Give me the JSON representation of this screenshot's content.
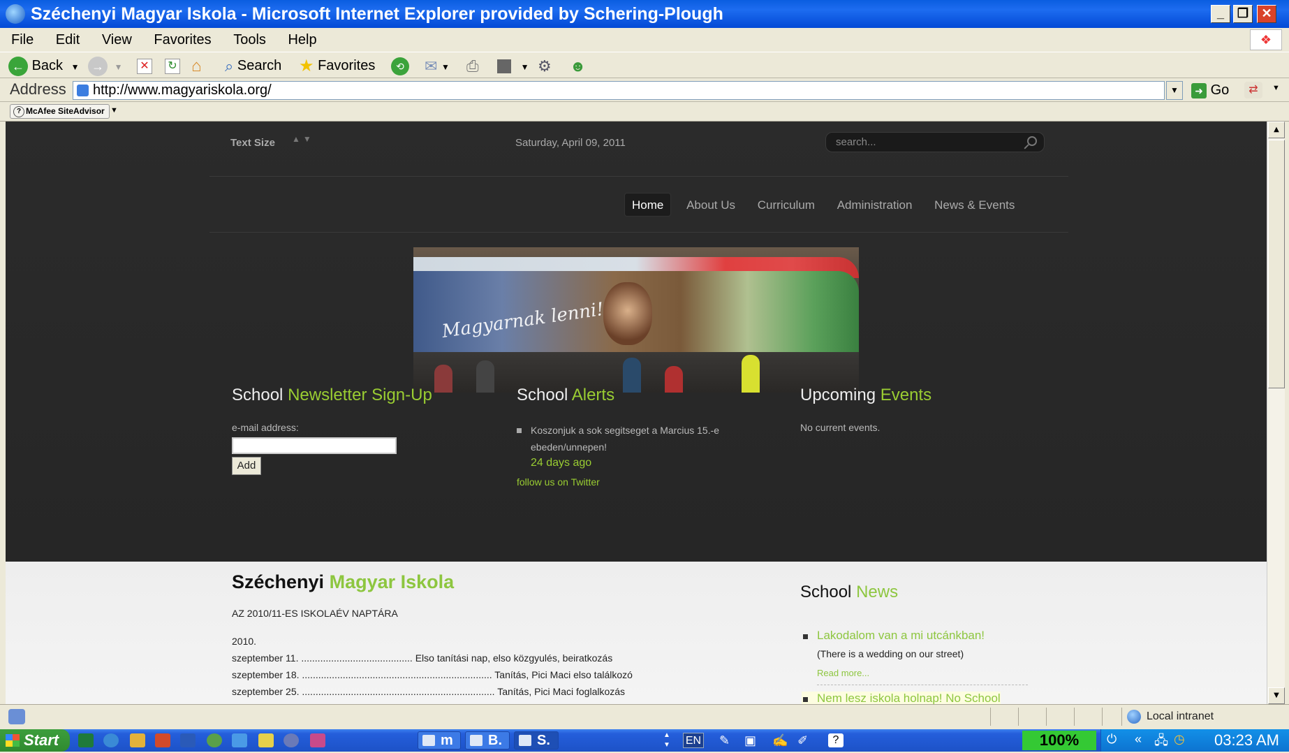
{
  "window": {
    "title": "Széchenyi Magyar Iskola - Microsoft Internet Explorer provided by Schering-Plough"
  },
  "menu": [
    "File",
    "Edit",
    "View",
    "Favorites",
    "Tools",
    "Help"
  ],
  "toolbar": {
    "back_label": "Back",
    "search_label": "Search",
    "favorites_label": "Favorites"
  },
  "address": {
    "label": "Address",
    "url": "http://www.magyariskola.org/",
    "go_label": "Go"
  },
  "siteadvisor": {
    "label": "McAfee SiteAdvisor"
  },
  "page": {
    "text_size_label": "Text Size",
    "date": "Saturday, April 09, 2011",
    "search_placeholder": "search...",
    "nav": [
      "Home",
      "About Us",
      "Curriculum",
      "Administration",
      "News & Events"
    ],
    "newsletter": {
      "title_a": "School",
      "title_b": "Newsletter Sign-Up",
      "email_label": "e-mail address:",
      "add_label": "Add"
    },
    "alerts": {
      "title_a": "School",
      "title_b": "Alerts",
      "item": "Koszonjuk a sok segitseget a Marcius 15.-e ebeden/unnepen!",
      "ago": "24 days ago",
      "follow": "follow us on Twitter"
    },
    "events": {
      "title_a": "Upcoming",
      "title_b": "Events",
      "empty": "No current events."
    },
    "main": {
      "title_a": "Széchenyi",
      "title_b": "Magyar Iskola",
      "subtitle": "AZ 2010/11-ES ISKOLAÉV NAPTÁRA",
      "year": "2010.",
      "calendar": [
        "szeptember 11. ......................................... Elso tanítási nap, elso közgyulés, beiratkozás",
        "szeptember 18. ...................................................................... Tanítás, Pici Maci elso találkozó",
        "szeptember 25. ....................................................................... Tanítás, Pici Maci foglalkozás"
      ]
    },
    "news": {
      "title_a": "School",
      "title_b": "News",
      "items": [
        {
          "title": "Lakodalom van a mi utcánkban!",
          "desc": "(There is a wedding on our street)",
          "more": "Read more..."
        },
        {
          "title": "Nem lesz iskola holnap! No School"
        }
      ]
    }
  },
  "status": {
    "zone": "Local intranet"
  },
  "taskbar": {
    "start_label": "Start",
    "tasks": [
      "m",
      "B.",
      "S."
    ],
    "lang": "EN",
    "battery": "100%",
    "clock": "03:23 AM"
  },
  "colors": {
    "accent_green": "#8dc63f",
    "dark_bg": "#2a2a2a",
    "xp_blue": "#0a5de0"
  }
}
